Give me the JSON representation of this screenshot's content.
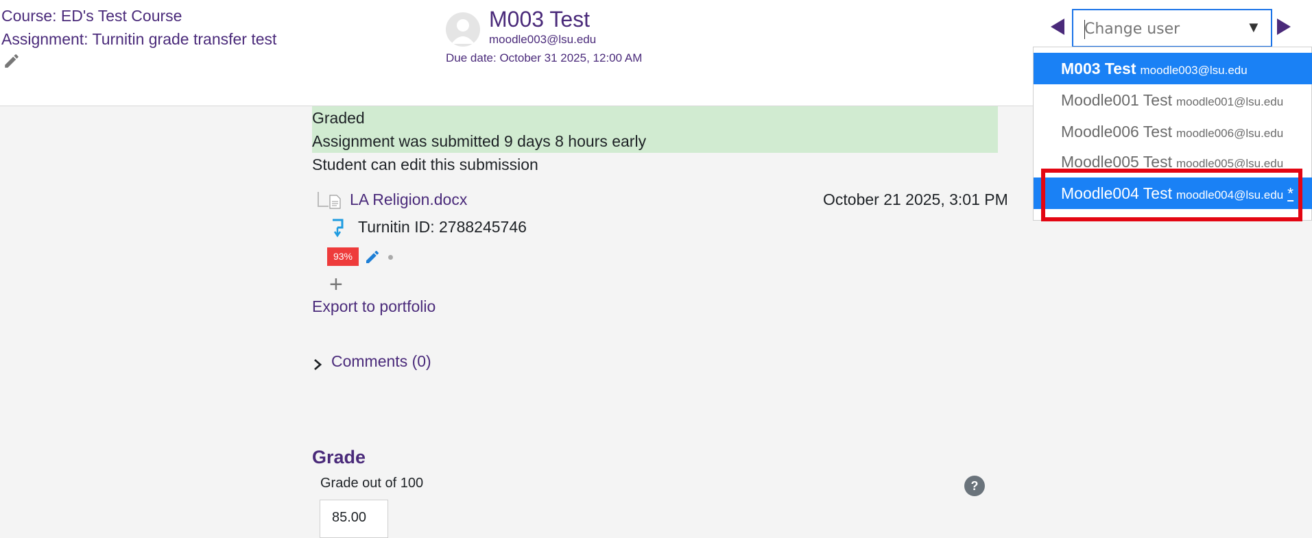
{
  "header": {
    "course_link": "Course: ED's Test Course",
    "assignment_link": "Assignment: Turnitin grade transfer test",
    "user_name": "M003 Test",
    "user_email": "moodle003@lsu.edu",
    "due_date": "Due date: October 31 2025, 12:00 AM",
    "change_user_placeholder": "Change user"
  },
  "dropdown": {
    "items": [
      {
        "name": "M003 Test",
        "email": "moodle003@lsu.edu",
        "active": true,
        "suffix": ""
      },
      {
        "name": "Moodle001 Test",
        "email": "moodle001@lsu.edu",
        "active": false,
        "suffix": ""
      },
      {
        "name": "Moodle006 Test",
        "email": "moodle006@lsu.edu",
        "active": false,
        "suffix": ""
      },
      {
        "name": "Moodle005 Test",
        "email": "moodle005@lsu.edu",
        "active": false,
        "suffix": ""
      },
      {
        "name": "Moodle004 Test",
        "email": "moodle004@lsu.edu",
        "active": true,
        "suffix": "*"
      }
    ]
  },
  "submission": {
    "status_graded": "Graded",
    "status_submitted": "Assignment was submitted 9 days 8 hours early",
    "status_edit": "Student can edit this submission",
    "file_name": "LA Religion.docx",
    "file_date": "October 21 2025, 3:01 PM",
    "turnitin_id": "Turnitin ID: 2788245746",
    "similarity": "93%",
    "export": "Export to portfolio",
    "comments": "Comments (0)"
  },
  "grade": {
    "heading": "Grade",
    "label": "Grade out of 100",
    "value": "85.00",
    "help": "?"
  },
  "colors": {
    "link": "#4a2a7a",
    "active_item": "#1a81f5",
    "highlight_border": "#e30613",
    "graded_bg": "#d1ebd1",
    "similarity_badge": "#ee3b3b"
  }
}
